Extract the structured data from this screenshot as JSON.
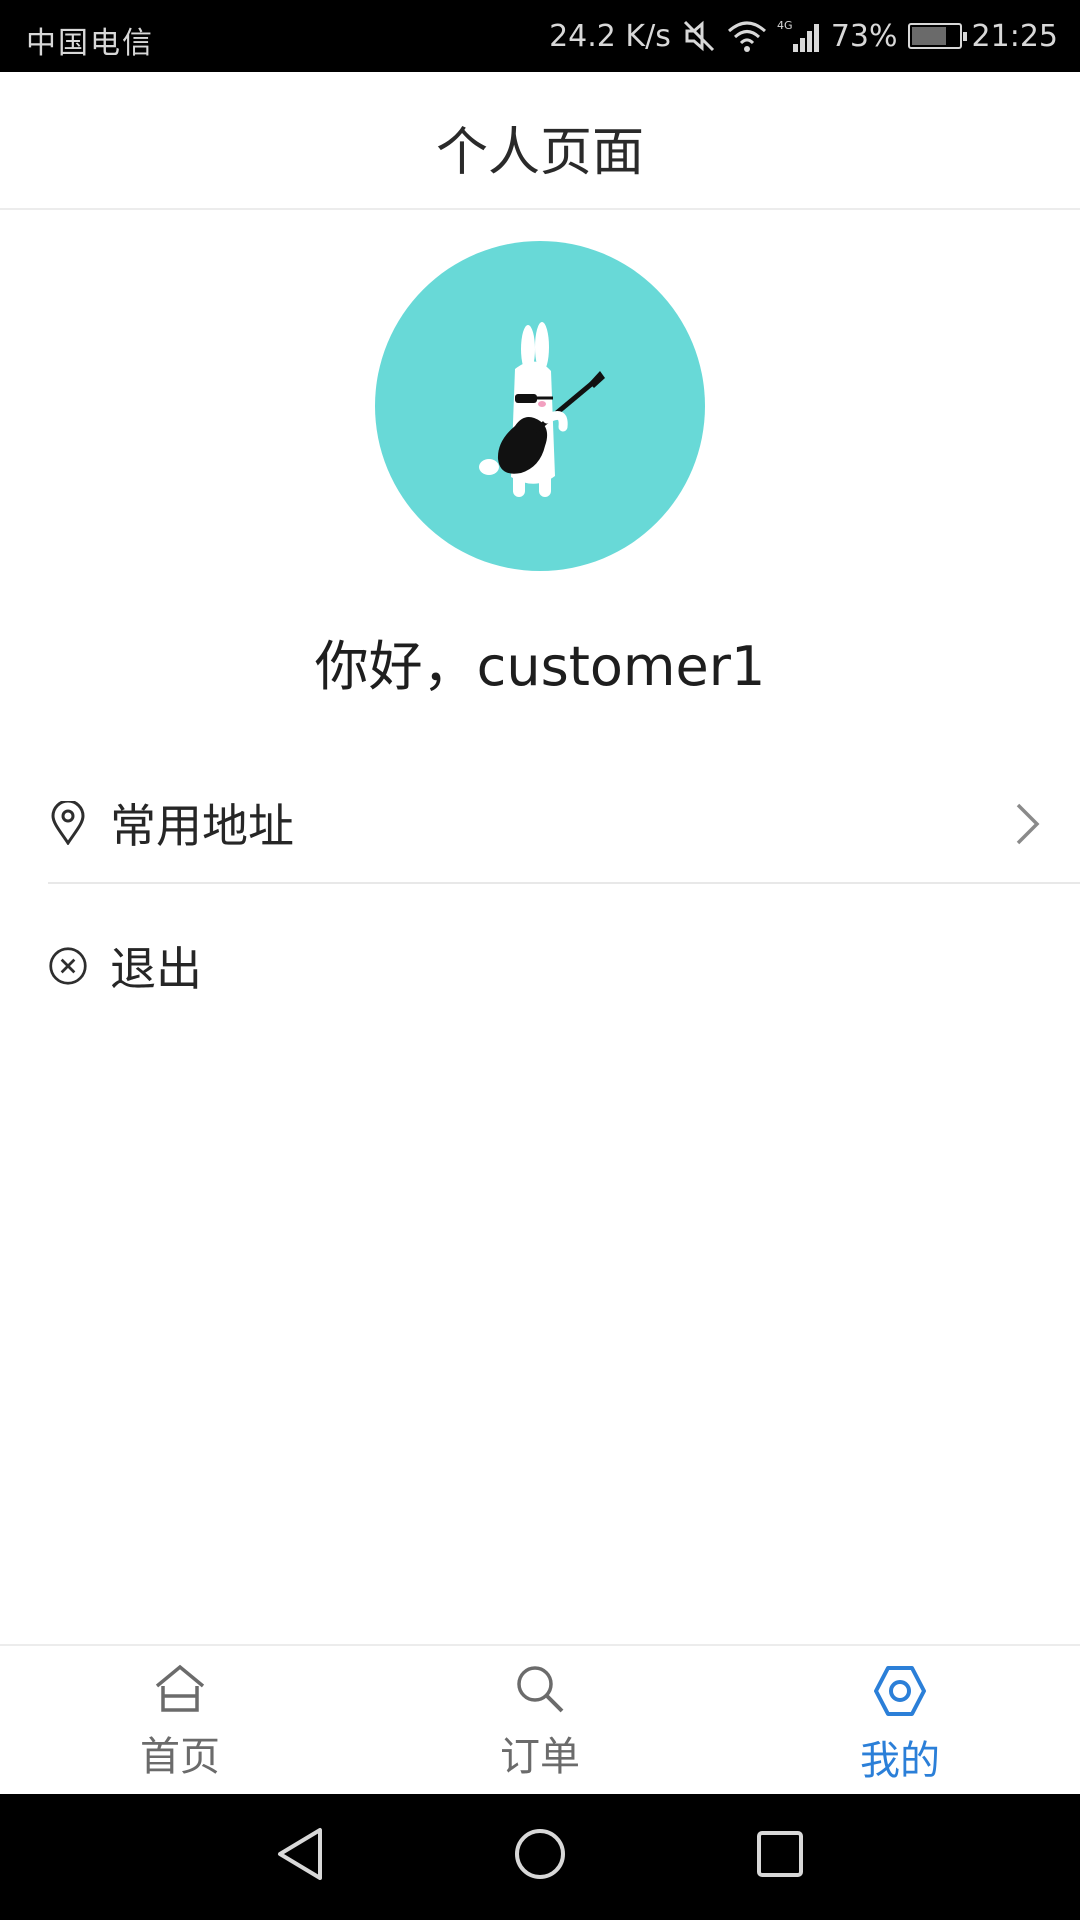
{
  "status_bar": {
    "carrier": "中国电信",
    "net_speed": "24.2 K/s",
    "battery_percent": "73%",
    "battery_level": 0.73,
    "time": "21:25",
    "icons": [
      "mute-icon",
      "wifi-icon",
      "4g-signal-icon",
      "battery-icon"
    ]
  },
  "header": {
    "title": "个人页面"
  },
  "profile": {
    "avatar_icon": "rabbit-guitar-avatar",
    "avatar_bg": "#68d9d7",
    "greeting": "你好，customer1"
  },
  "menu": {
    "items": [
      {
        "label": "常用地址",
        "icon": "location-pin-icon",
        "has_chevron": true
      },
      {
        "label": "退出",
        "icon": "close-circle-icon",
        "has_chevron": false
      }
    ]
  },
  "bottom_nav": {
    "active_color": "#2b7fd8",
    "items": [
      {
        "label": "首页",
        "icon": "home-icon",
        "active": false
      },
      {
        "label": "订单",
        "icon": "search-icon",
        "active": false
      },
      {
        "label": "我的",
        "icon": "gear-icon",
        "active": true
      }
    ]
  },
  "system_nav": {
    "icons": [
      "back-icon",
      "home-circle-icon",
      "recents-icon"
    ]
  }
}
